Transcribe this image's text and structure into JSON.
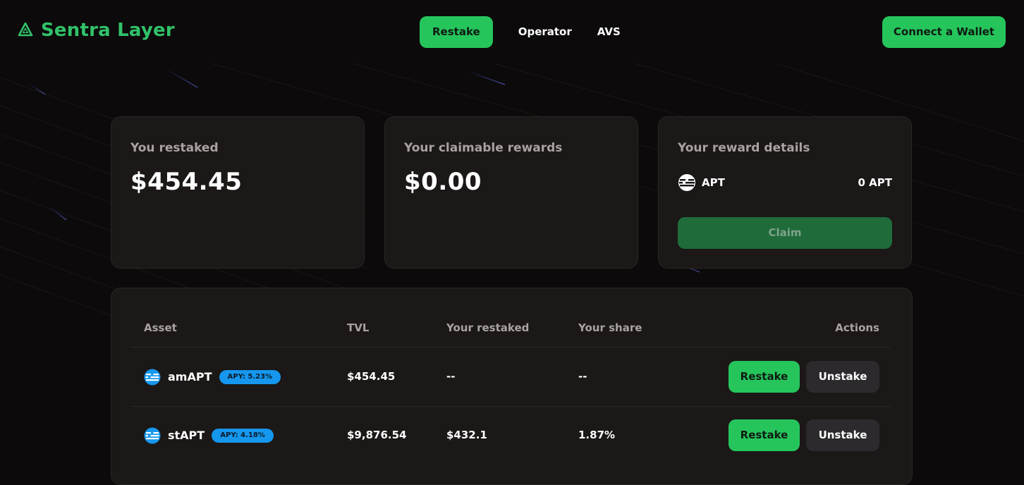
{
  "app": {
    "brand_name": "Sentra Layer",
    "icons": {
      "logo": "recycle-triangle-logo",
      "apt": "aptos-token-icon",
      "blue_token": "blue-token-icon"
    },
    "colors": {
      "accent": "#25c55c",
      "brand_text": "#31c26a",
      "claim_disabled": "#1f6b3a",
      "badge": "#1597ee",
      "background": "#0c0a0a",
      "card": "#1b1817"
    }
  },
  "nav": {
    "tabs": [
      {
        "label": "Restake",
        "active": true
      },
      {
        "label": "Operator",
        "active": false
      },
      {
        "label": "AVS",
        "active": false
      }
    ],
    "connect_label": "Connect a Wallet"
  },
  "cards": {
    "restaked": {
      "label": "You restaked",
      "value": "$454.45"
    },
    "claimable": {
      "label": "Your claimable rewards",
      "value": "$0.00"
    },
    "reward_details": {
      "label": "Your reward details",
      "asset": "APT",
      "amount": "0 APT",
      "claim_label": "Claim"
    }
  },
  "table": {
    "headers": [
      "Asset",
      "TVL",
      "Your restaked",
      "Your share",
      "Actions"
    ],
    "rows": [
      {
        "asset": "amAPT",
        "apy": "APY: 5.23%",
        "tvl": "$454.45",
        "restaked": "--",
        "share": "--",
        "restake_label": "Restake",
        "unstake_label": "Unstake"
      },
      {
        "asset": "stAPT",
        "apy": "APY: 4.18%",
        "tvl": "$9,876.54",
        "restaked": "$432.1",
        "share": "1.87%",
        "restake_label": "Restake",
        "unstake_label": "Unstake"
      }
    ]
  }
}
